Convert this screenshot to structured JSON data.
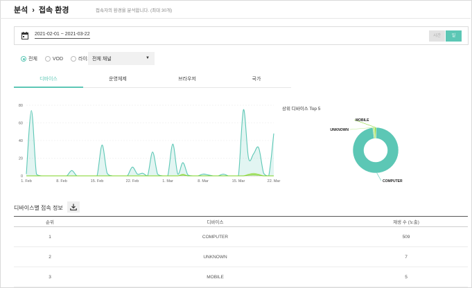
{
  "header": {
    "breadcrumb_root": "분석",
    "breadcrumb_current": "접속 환경",
    "description": "접속자의 환경을 분석합니다. (최대 30개)"
  },
  "date_filter": {
    "range": "2021-02-01 ~ 2021-03-22",
    "hour_button": "시간",
    "day_button": "일"
  },
  "filters": {
    "radios": [
      {
        "label": "전체",
        "selected": true
      },
      {
        "label": "VOD",
        "selected": false
      },
      {
        "label": "라이브",
        "selected": false
      }
    ],
    "channel_select": "전체 채널"
  },
  "tabs": [
    "디바이스",
    "운영체제",
    "브라우저",
    "국가"
  ],
  "active_tab": 0,
  "colors": {
    "accent": "#5cc7b5",
    "line_light": "#b8e986",
    "line_mid": "#7ed321"
  },
  "chart_data": [
    {
      "type": "area",
      "ylim": [
        0,
        80
      ],
      "yticks": [
        0,
        20,
        40,
        60,
        80
      ],
      "xticks": [
        "1. Feb",
        "8. Feb",
        "15. Feb",
        "22. Feb",
        "1. Mar",
        "8. Mar",
        "15. Mar",
        "22. Mar"
      ],
      "x": [
        "2021-02-01",
        "2021-02-02",
        "2021-02-03",
        "2021-02-04",
        "2021-02-05",
        "2021-02-06",
        "2021-02-07",
        "2021-02-08",
        "2021-02-09",
        "2021-02-10",
        "2021-02-11",
        "2021-02-12",
        "2021-02-13",
        "2021-02-14",
        "2021-02-15",
        "2021-02-16",
        "2021-02-17",
        "2021-02-18",
        "2021-02-19",
        "2021-02-20",
        "2021-02-21",
        "2021-02-22",
        "2021-02-23",
        "2021-02-24",
        "2021-02-25",
        "2021-02-26",
        "2021-02-27",
        "2021-02-28",
        "2021-03-01",
        "2021-03-02",
        "2021-03-03",
        "2021-03-04",
        "2021-03-05",
        "2021-03-06",
        "2021-03-07",
        "2021-03-08",
        "2021-03-09",
        "2021-03-10",
        "2021-03-11",
        "2021-03-12",
        "2021-03-13",
        "2021-03-14",
        "2021-03-15",
        "2021-03-16",
        "2021-03-17",
        "2021-03-18",
        "2021-03-19",
        "2021-03-20",
        "2021-03-21",
        "2021-03-22"
      ],
      "series": [
        {
          "name": "COMPUTER",
          "color": "#5cc7b5",
          "values": [
            2,
            74,
            2,
            0,
            0,
            0,
            0,
            0,
            0,
            6,
            0,
            0,
            0,
            0,
            0,
            35,
            3,
            0,
            0,
            0,
            0,
            10,
            2,
            3,
            0,
            27,
            2,
            0,
            0,
            36,
            2,
            15,
            1,
            0,
            0,
            2,
            1,
            0,
            0,
            2,
            0,
            0,
            0,
            75,
            20,
            25,
            32,
            3,
            0,
            48
          ]
        },
        {
          "name": "UNKNOWN",
          "color": "#b8e986",
          "values": [
            0,
            0,
            0,
            0,
            0,
            0,
            0,
            0,
            0,
            0,
            0,
            0,
            0,
            0,
            0,
            0,
            0,
            0,
            0,
            0,
            0,
            0,
            0,
            0,
            0,
            0,
            0,
            0,
            0,
            0,
            0,
            2,
            0,
            0,
            0,
            0,
            0,
            0,
            0,
            0,
            0,
            0,
            0,
            0,
            2,
            3,
            2,
            0,
            0,
            0
          ]
        },
        {
          "name": "MOBILE",
          "color": "#7ed321",
          "values": [
            0,
            0,
            0,
            0,
            0,
            0,
            0,
            0,
            0,
            0,
            0,
            0,
            0,
            0,
            0,
            0,
            0,
            0,
            0,
            0,
            0,
            0,
            0,
            0,
            0,
            0,
            0,
            0,
            0,
            0,
            0,
            1,
            0,
            0,
            0,
            0,
            0,
            0,
            0,
            0,
            0,
            0,
            0,
            0,
            1,
            2,
            1,
            0,
            0,
            0
          ]
        }
      ]
    },
    {
      "type": "pie",
      "title": "상위 디바이스 Top 5",
      "labels": [
        "COMPUTER",
        "UNKNOWN",
        "MOBILE"
      ],
      "values": [
        509,
        7,
        5
      ],
      "colors": [
        "#5cc7b5",
        "#b8e986",
        "#7ed321"
      ]
    }
  ],
  "device_table": {
    "title": "디바이스별 접속 정보",
    "download_icon": "download-icon",
    "columns": [
      "순위",
      "디바이스",
      "재생 수 (노출)"
    ],
    "rows": [
      [
        "1",
        "COMPUTER",
        "509"
      ],
      [
        "2",
        "UNKNOWN",
        "7"
      ],
      [
        "3",
        "MOBILE",
        "5"
      ]
    ]
  }
}
